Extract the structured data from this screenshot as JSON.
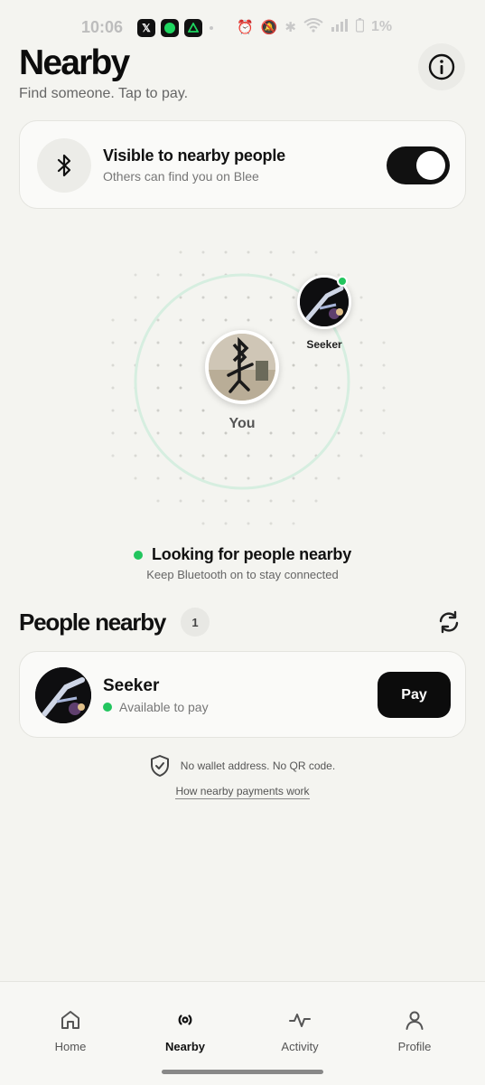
{
  "status_bar": {
    "time": "10:06",
    "apps": [
      "x-app-icon",
      "spotify-app-icon",
      "drive-app-icon"
    ],
    "battery": "1%"
  },
  "header": {
    "title": "Nearby",
    "subtitle": "Find someone. Tap to pay.",
    "info_icon": "info-icon"
  },
  "visibility": {
    "title": "Visible to nearby people",
    "subtitle": "Others can find you on Blee",
    "enabled": true,
    "icon": "bluetooth-icon"
  },
  "radar": {
    "you_label": "You",
    "peer_label": "Seeker"
  },
  "scan_status": {
    "title": "Looking for people nearby",
    "subtitle": "Keep Bluetooth on to stay connected",
    "color": "#22c55e"
  },
  "people": {
    "title": "People nearby",
    "count": "1",
    "items": [
      {
        "name": "Seeker",
        "status": "Available to pay",
        "action": "Pay"
      }
    ]
  },
  "privacy": {
    "text": "No wallet address. No QR code.",
    "link": "How nearby payments work"
  },
  "nav": {
    "items": [
      {
        "label": "Home",
        "icon": "home-icon"
      },
      {
        "label": "Nearby",
        "icon": "nearby-icon",
        "active": true
      },
      {
        "label": "Activity",
        "icon": "activity-icon"
      },
      {
        "label": "Profile",
        "icon": "profile-icon"
      }
    ]
  }
}
